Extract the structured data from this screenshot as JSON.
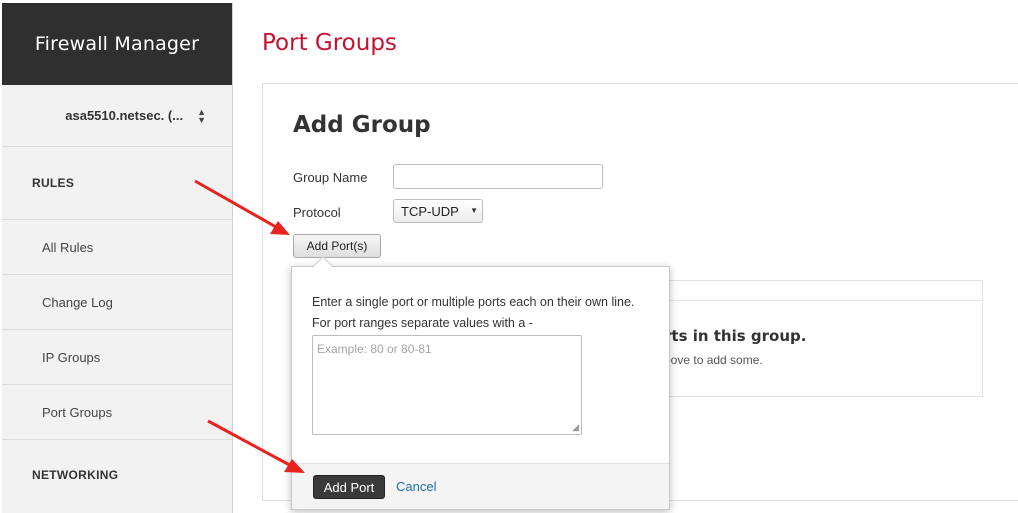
{
  "app": {
    "title": "Firewall Manager"
  },
  "sidebar": {
    "device": "asa5510.netsec. (...",
    "sections": [
      {
        "label": "RULES"
      },
      {
        "label": "NETWORKING"
      }
    ],
    "items": [
      {
        "label": "All Rules"
      },
      {
        "label": "Change Log"
      },
      {
        "label": "IP Groups"
      },
      {
        "label": "Port Groups"
      }
    ]
  },
  "page": {
    "title": "Port Groups"
  },
  "form": {
    "title": "Add Group",
    "group_name_label": "Group Name",
    "group_name_value": "",
    "protocol_label": "Protocol",
    "protocol_value": "TCP-UDP",
    "add_ports_label": "Add Port(s)"
  },
  "empty_state": {
    "title_partial": "rts in this group.",
    "subtitle_partial": "bove to add some."
  },
  "popover": {
    "line1": "Enter a single port or multiple ports each on their own line.",
    "line2": "For port ranges separate values with a -",
    "placeholder": "Example: 80 or 80-81",
    "add_label": "Add Port",
    "cancel_label": "Cancel"
  },
  "colors": {
    "title_red": "#c41230",
    "annotation_arrow": "#e8231e",
    "link_blue": "#1f6fb5"
  }
}
